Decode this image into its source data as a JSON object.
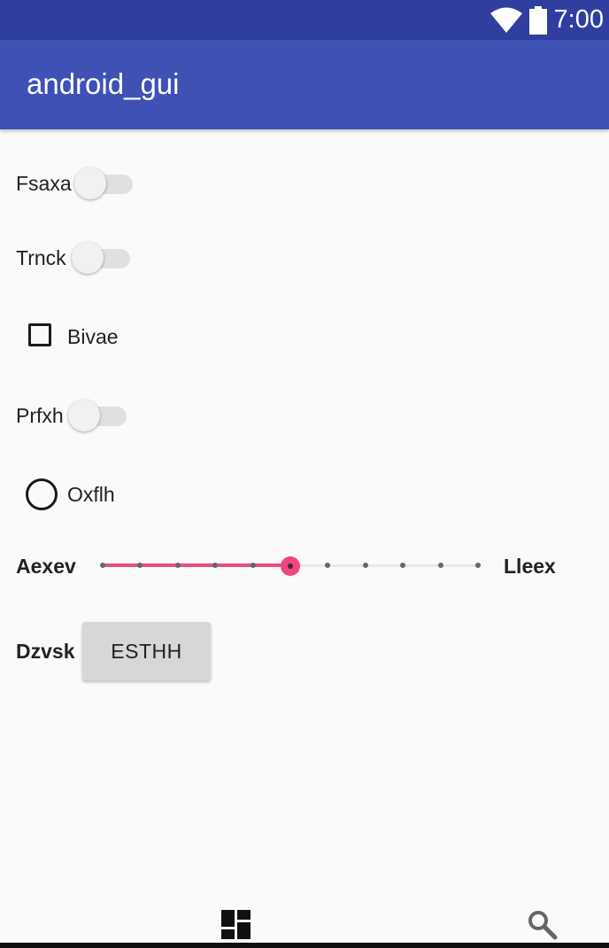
{
  "status_bar": {
    "time": "7:00",
    "icons": [
      "wifi-icon",
      "battery-icon"
    ]
  },
  "app_bar": {
    "title": "android_gui"
  },
  "controls": {
    "switch1": {
      "label": "Fsaxa",
      "checked": false
    },
    "switch2": {
      "label": "Trnck",
      "checked": false
    },
    "checkbox1": {
      "label": "Bivae",
      "checked": false
    },
    "switch3": {
      "label": "Prfxh",
      "checked": false
    },
    "radio1": {
      "label": "Oxflh",
      "checked": false
    },
    "slider1": {
      "left_label": "Aexev",
      "right_label": "Lleex",
      "value": 5,
      "max": 10
    },
    "button_row": {
      "label": "Dzvsk",
      "button_text": "ESTHH"
    }
  },
  "bottom_nav": {
    "icons": [
      "dashboard-icon",
      "search-icon"
    ]
  },
  "colors": {
    "primary": "#3f51b5",
    "primary_dark": "#303f9f",
    "accent": "#e94e83"
  }
}
